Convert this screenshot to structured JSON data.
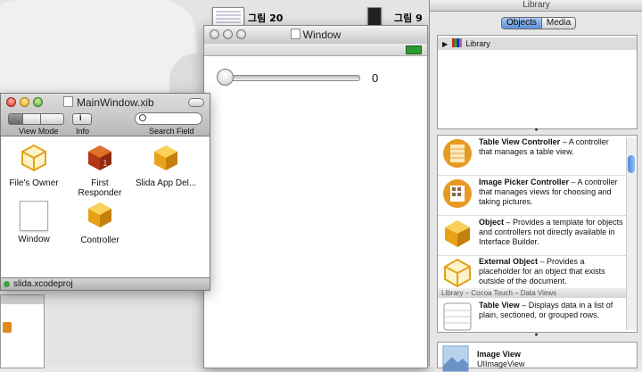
{
  "desktop": {
    "thumb1_label": "그림 20",
    "thumb2_label": "그림 9"
  },
  "window": {
    "title": "Window",
    "slider_value": "0",
    "slider_fraction": 0
  },
  "xib": {
    "title": "MainWindow.xib",
    "toolbar": {
      "view_mode_label": "View Mode",
      "info_label": "Info",
      "search_label": "Search Field"
    },
    "objects": [
      {
        "label": "File's Owner",
        "icon": "cube-outline-icon"
      },
      {
        "label": "First Responder",
        "icon": "red-cube-icon"
      },
      {
        "label": "Slida App Del...",
        "icon": "cube-icon"
      },
      {
        "label": "Window",
        "icon": "window-icon"
      },
      {
        "label": "Controller",
        "icon": "cube-icon"
      }
    ],
    "status": "slida.xcodeproj"
  },
  "library": {
    "title": "Library",
    "tabs": [
      "Objects",
      "Media"
    ],
    "tree_item": "Library",
    "items": [
      {
        "name": "Table View Controller",
        "desc": " – A controller that manages a table view."
      },
      {
        "name": "Image Picker Controller",
        "desc": " – A controller that manages views for choosing and taking pictures."
      },
      {
        "name": "Object",
        "desc": " – Provides a template for objects and controllers not directly available in Interface Builder."
      },
      {
        "name": "External Object",
        "desc": " – Provides a placeholder for an object that exists outside of the document."
      }
    ],
    "section_header": "Library – Cocoa Touch – Data Views",
    "items2": [
      {
        "name": "Table View",
        "desc": " – Displays data in a list of plain, sectioned, or grouped rows."
      }
    ],
    "bottom_item": {
      "name": "Image View",
      "sub": "UIImageView"
    }
  }
}
